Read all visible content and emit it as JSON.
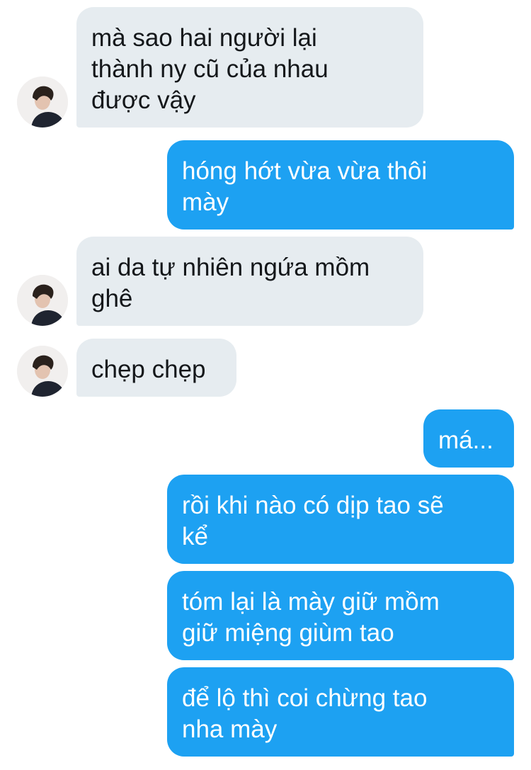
{
  "conversation": {
    "messages": [
      {
        "sender": "contact",
        "text": "mà sao hai người lại\nthành ny cũ của nhau\nđược vậy"
      },
      {
        "sender": "me",
        "text": "hóng hớt vừa vừa thôi\nmày"
      },
      {
        "sender": "contact",
        "text": "ai da tự nhiên ngứa mồm\nghê"
      },
      {
        "sender": "contact",
        "text": "chẹp chẹp"
      },
      {
        "sender": "me",
        "text": "má..."
      },
      {
        "sender": "me",
        "text": "rồi khi nào có dịp tao sẽ\nkể"
      },
      {
        "sender": "me",
        "text": "tóm lại là mày giữ mồm\ngiữ miệng giùm tao"
      },
      {
        "sender": "me",
        "text": "để lộ thì coi chừng tao\nnha mày"
      }
    ]
  },
  "contact": {
    "avatar_icon": "user-avatar-icon"
  },
  "colors": {
    "incoming_bubble": "#e6ecf0",
    "incoming_text": "#14171a",
    "outgoing_bubble": "#1da1f2",
    "outgoing_text": "#ffffff"
  }
}
